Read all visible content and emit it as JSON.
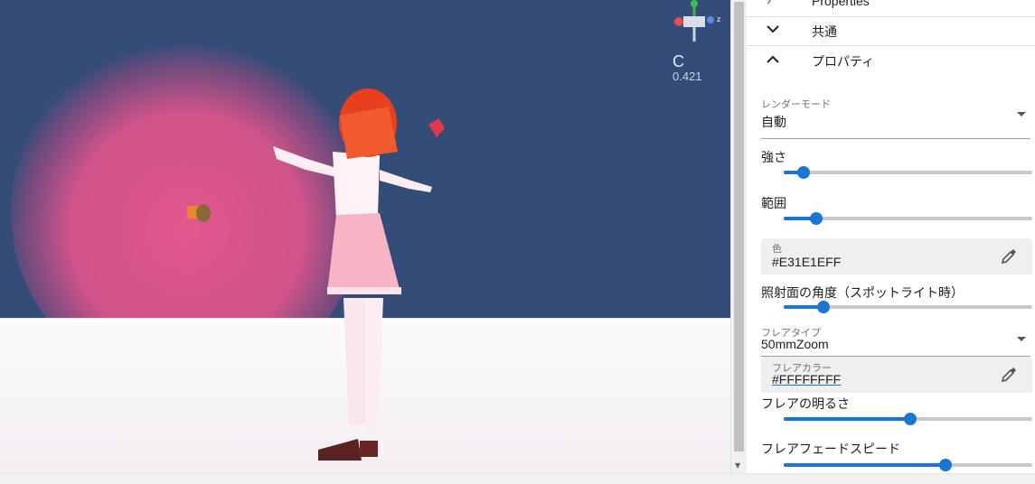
{
  "viewport": {
    "camera_label": "C",
    "camera_value": "0.421",
    "gizmo_axis_label": "z"
  },
  "panel": {
    "sections": [
      {
        "label": "Properties",
        "state": "collapsed"
      },
      {
        "label": "共通",
        "state": "expanded"
      },
      {
        "label": "プロパティ",
        "state": "expanded"
      }
    ],
    "render_mode": {
      "caption": "レンダーモード",
      "value": "自動"
    },
    "intensity": {
      "label": "強さ",
      "value": 0.08
    },
    "range": {
      "label": "範囲",
      "value": 0.13
    },
    "color": {
      "caption": "色",
      "value": "#E31E1EFF"
    },
    "spot_angle": {
      "label": "照射面の角度（スポットライト時）",
      "value": 0.16
    },
    "flare_type": {
      "caption": "フレアタイプ",
      "value": "50mmZoom"
    },
    "flare_color": {
      "caption": "フレアカラー",
      "value": "#FFFFFFFF"
    },
    "flare_brightness": {
      "label": "フレアの明るさ",
      "value": 0.51
    },
    "flare_fade_speed": {
      "label": "フレアフェードスピード",
      "value": 0.65
    }
  },
  "colors": {
    "accent": "#1976d2",
    "viewport_bg": "#334c78",
    "light_glow": "#e3568c",
    "light_color": "#e31e1e"
  }
}
